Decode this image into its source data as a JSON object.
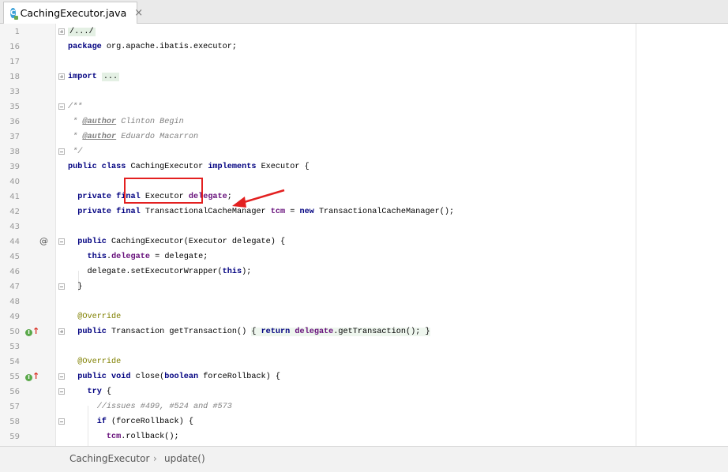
{
  "tab": {
    "icon": "class-c-icon",
    "icon_letter": "C",
    "label": "CachingExecutor.java",
    "close": "×"
  },
  "lines": [
    {
      "n": "1",
      "fold": "plus",
      "html": "<span class=\"foldtext\">/.../</span>"
    },
    {
      "n": "16",
      "fold": "",
      "html": "<span class=\"kw\">package</span> org.apache.ibatis.executor;"
    },
    {
      "n": "17",
      "fold": "",
      "html": ""
    },
    {
      "n": "18",
      "fold": "plus",
      "html": "<span class=\"kw\">import</span> <span class=\"foldtext\">...</span>"
    },
    {
      "n": "33",
      "fold": "",
      "html": ""
    },
    {
      "n": "35",
      "fold": "minus",
      "html": "<span class=\"cmt\">/**</span>"
    },
    {
      "n": "36",
      "fold": "",
      "html": "<span class=\"cmt\"> * </span><span class=\"tag\">@author</span><span class=\"cmt\"> Clinton Begin</span>"
    },
    {
      "n": "37",
      "fold": "",
      "html": "<span class=\"cmt\"> * </span><span class=\"tag\">@author</span><span class=\"cmt\"> Eduardo Macarron</span>"
    },
    {
      "n": "38",
      "fold": "minus",
      "html": "<span class=\"cmt\"> */</span>"
    },
    {
      "n": "39",
      "fold": "",
      "html": "<span class=\"kw\">public class</span> CachingExecutor <span class=\"kw\">implements</span> Executor {"
    },
    {
      "n": "40",
      "fold": "",
      "html": ""
    },
    {
      "n": "41",
      "fold": "",
      "html": "  <span class=\"kw\">private final</span> Executor <span class=\"field\">delegate</span>;"
    },
    {
      "n": "42",
      "fold": "",
      "html": "  <span class=\"kw\">private final</span> TransactionalCacheManager <span class=\"field\">tcm</span> = <span class=\"kw\">new</span> TransactionalCacheManager();"
    },
    {
      "n": "43",
      "fold": "",
      "html": ""
    },
    {
      "n": "44",
      "fold": "minus",
      "icon": "at",
      "html": "  <span class=\"kw\">public</span> CachingExecutor(Executor delegate) {"
    },
    {
      "n": "45",
      "fold": "",
      "html": "    <span class=\"kw\">this</span>.<span class=\"field\">delegate</span> = delegate;"
    },
    {
      "n": "46",
      "fold": "",
      "html": "    delegate.setExecutorWrapper(<span class=\"kw\">this</span>);"
    },
    {
      "n": "47",
      "fold": "minus",
      "html": "  }"
    },
    {
      "n": "48",
      "fold": "",
      "html": ""
    },
    {
      "n": "49",
      "fold": "",
      "html": "  <span class=\"ann\">@Override</span>"
    },
    {
      "n": "50",
      "fold": "plus",
      "icon": "impl",
      "html": "  <span class=\"kw\">public</span> Transaction getTransaction() <span class=\"hl\">{ <span class=\"kw\">return</span> <span class=\"field\">delegate</span>.getTransaction(); }</span>"
    },
    {
      "n": "53",
      "fold": "",
      "html": ""
    },
    {
      "n": "54",
      "fold": "",
      "html": "  <span class=\"ann\">@Override</span>"
    },
    {
      "n": "55",
      "fold": "minus",
      "icon": "impl",
      "html": "  <span class=\"kw\">public void</span> close(<span class=\"kw\">boolean</span> forceRollback) {"
    },
    {
      "n": "56",
      "fold": "minus",
      "html": "    <span class=\"kw\">try</span> {"
    },
    {
      "n": "57",
      "fold": "",
      "html": "      <span class=\"cmt\">//issues #499, #524 and #573</span>"
    },
    {
      "n": "58",
      "fold": "minus",
      "html": "      <span class=\"kw\">if</span> (forceRollback) {"
    },
    {
      "n": "59",
      "fold": "",
      "html": "        <span class=\"field\">tcm</span>.rollback();"
    }
  ],
  "breadcrumb": {
    "class": "CachingExecutor",
    "separator": "›",
    "method": "update()"
  }
}
